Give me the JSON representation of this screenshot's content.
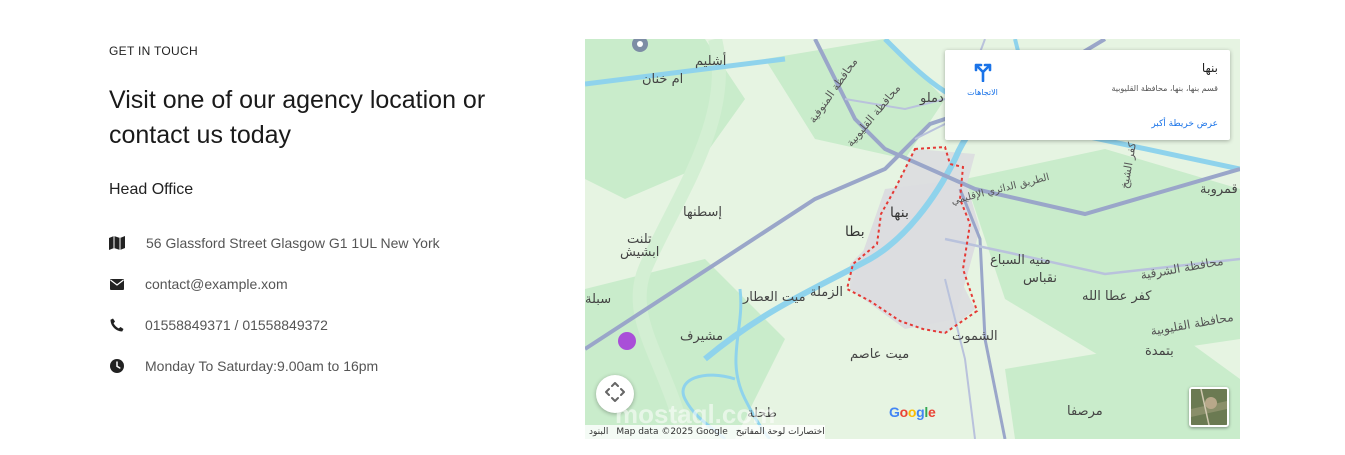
{
  "contact": {
    "eyebrow": "GET IN TOUCH",
    "heading": "Visit one of our agency location or contact us today",
    "office_title": "Head Office",
    "items": [
      {
        "icon": "map-icon",
        "text": "56 Glassford Street Glasgow G1 1UL New York"
      },
      {
        "icon": "envelope-icon",
        "text": "contact@example.xom"
      },
      {
        "icon": "phone-icon",
        "text": "01558849371 / 01558849372"
      },
      {
        "icon": "clock-icon",
        "text": "Monday To Saturday:9.00am to 16pm"
      }
    ]
  },
  "map": {
    "card": {
      "place": "بنها",
      "address": "قسم بنها، بنها، محافظة القليوبية",
      "directions_label": "الاتجاهات",
      "larger_map_link": "عرض خريطة أكبر"
    },
    "labels": [
      {
        "text": "أشليم"
      },
      {
        "text": "ام خنان"
      },
      {
        "text": "محافظة المنوفية"
      },
      {
        "text": "محافظة القليوبية"
      },
      {
        "text": "دملو"
      },
      {
        "text": "بنها"
      },
      {
        "text": "إسطنها"
      },
      {
        "text": "تلنت"
      },
      {
        "text": "ابشيش"
      },
      {
        "text": "بطا"
      },
      {
        "text": "الزملة"
      },
      {
        "text": "ميت العطار"
      },
      {
        "text": "منيه السباع"
      },
      {
        "text": "نقباس"
      },
      {
        "text": "كفر عطا الله"
      },
      {
        "text": "محافظة الشرقية"
      },
      {
        "text": "محافظة القليوبية"
      },
      {
        "text": "بتمدة"
      },
      {
        "text": "الشموت"
      },
      {
        "text": "ميت عاصم"
      },
      {
        "text": "مشيرف"
      },
      {
        "text": "طحلة"
      },
      {
        "text": "مرصفا"
      },
      {
        "text": "كفر الشيخ"
      },
      {
        "text": "قمروبة"
      },
      {
        "text": "سبلة"
      },
      {
        "text": "الطريق الدائري الإقليمي"
      }
    ],
    "google_logo": "Google",
    "attribution": {
      "shortcuts": "اختصارات لوحة المفاتيح",
      "map_data": "Map data ©2025 Google",
      "terms": "البنود"
    },
    "watermark": "mostaql.com",
    "colors": {
      "land": "#e8f5e4",
      "green": "#c8ecc9",
      "water": "#8fd3ec",
      "road": "#9aa6c9",
      "boundary": "#e53935",
      "link": "#1a73e8"
    }
  }
}
